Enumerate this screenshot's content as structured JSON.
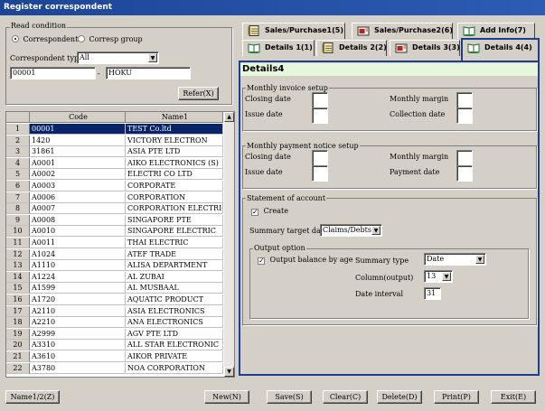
{
  "window": {
    "title": "Register correspondent"
  },
  "read_condition": {
    "title": "Read condition",
    "radio_correspondent": "Correspondent",
    "radio_corresp_group": "Corresp group",
    "type_label": "Correspondent type",
    "type_value": "All",
    "code_value": "00001",
    "separator": "-",
    "name_value": "HOKU",
    "refer_button": "Refer(X)"
  },
  "grid": {
    "col_code": "Code",
    "col_name": "Name1",
    "rows": [
      {
        "n": "1",
        "code": "00001",
        "name": "TEST Co.ltd"
      },
      {
        "n": "2",
        "code": "1420",
        "name": "VICTORY ELECTRON"
      },
      {
        "n": "3",
        "code": "31861",
        "name": "ASIA PTE LTD"
      },
      {
        "n": "4",
        "code": "A0001",
        "name": "AIKO ELECTRONICS (S)"
      },
      {
        "n": "5",
        "code": "A0002",
        "name": "ELECTRI CO LTD"
      },
      {
        "n": "6",
        "code": "A0003",
        "name": "CORPORATE"
      },
      {
        "n": "7",
        "code": "A0006",
        "name": "CORPORATION"
      },
      {
        "n": "8",
        "code": "A0007",
        "name": "CORPORATION ELECTRIC"
      },
      {
        "n": "9",
        "code": "A0008",
        "name": "SINGAPORE PTE"
      },
      {
        "n": "10",
        "code": "A0010",
        "name": "SINGAPORE ELECTRIC"
      },
      {
        "n": "11",
        "code": "A0011",
        "name": "THAI ELECTRIC"
      },
      {
        "n": "12",
        "code": "A1024",
        "name": "ATEF TRADE"
      },
      {
        "n": "13",
        "code": "A1110",
        "name": "ALISA   DEPARTMENT"
      },
      {
        "n": "14",
        "code": "A1224",
        "name": "AL ZUBAI"
      },
      {
        "n": "15",
        "code": "A1599",
        "name": "AL MUSBAAL"
      },
      {
        "n": "16",
        "code": "A1720",
        "name": "AQUATIC PRODUCT"
      },
      {
        "n": "17",
        "code": "A2110",
        "name": "ASIA ELECTRONICS"
      },
      {
        "n": "18",
        "code": "A2210",
        "name": "ANA ELECTRONICS"
      },
      {
        "n": "19",
        "code": "A2999",
        "name": "AGV PTE LTD"
      },
      {
        "n": "20",
        "code": "A3310",
        "name": "ALL STAR ELECTRONIC"
      },
      {
        "n": "21",
        "code": "A3610",
        "name": "AIKOR PRIVATE"
      },
      {
        "n": "22",
        "code": "A3780",
        "name": "NOA CORPORATION"
      }
    ]
  },
  "tabs": {
    "sales_purchase1": "Sales/Purchase1(5)",
    "sales_purchase2": "Sales/Purchase2(6)",
    "add_info": "Add Info(7)",
    "details1": "Details 1(1)",
    "details2": "Details 2(2)",
    "details3": "Details 3(3)",
    "details4": "Details 4(4)"
  },
  "details4": {
    "heading": "Details4",
    "invoice": {
      "title": "Monthly invoice setup",
      "closing_date": "Closing date",
      "issue_date": "Issue date",
      "monthly_margin": "Monthly margin",
      "collection_date": "Collection date"
    },
    "payment": {
      "title": "Monthly payment notice setup",
      "closing_date": "Closing date",
      "issue_date": "Issue date",
      "monthly_margin": "Monthly margin",
      "payment_date": "Payment date"
    },
    "statement": {
      "title": "Statement of account",
      "create_label": "Create",
      "create_checked": true,
      "summary_target_label": "Summary target data",
      "summary_target_value": "Claims/Debts",
      "output_option": {
        "title": "Output option",
        "balance_label": "Output balance by age",
        "balance_checked": true,
        "summary_type_label": "Summary type",
        "summary_type_value": "Date",
        "column_output_label": "Column(output)",
        "column_output_value": "13",
        "date_interval_label": "Date interval",
        "date_interval_value": "31"
      }
    }
  },
  "bottom": {
    "name12": "Name1/2(Z)",
    "new": "New(N)",
    "save": "Save(S)",
    "clear": "Clear(C)",
    "delete": "Delete(D)",
    "print": "Print(P)",
    "exit": "Exit(E)"
  },
  "colors": {
    "title_bar": "#1d4596",
    "panel_border": "#1e3f8f",
    "heading_bg": "#e6f7de",
    "selected_row": "#0a246a"
  }
}
